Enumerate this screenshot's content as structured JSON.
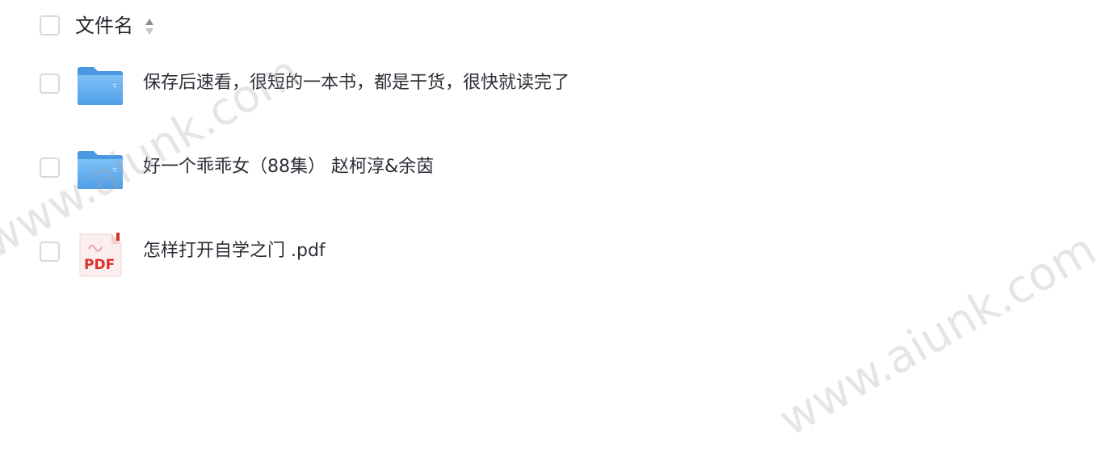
{
  "header": {
    "column_label": "文件名",
    "sort_icon": "sort-updown-icon"
  },
  "files": [
    {
      "name": "保存后速看，很短的一本书，都是干货，很快就读完了",
      "icon": "folder-icon",
      "checked": false
    },
    {
      "name": "好一个乖乖女（88集） 赵柯淳&余茵",
      "icon": "folder-icon",
      "checked": false
    },
    {
      "name": "怎样打开自学之门 .pdf",
      "icon": "pdf-file-icon",
      "icon_label": "PDF",
      "checked": false
    }
  ],
  "watermark": "www.aiunk.com",
  "colors": {
    "folder": "#5aa9f0",
    "pdf_red": "#d9322b",
    "text": "#2b2f36"
  }
}
